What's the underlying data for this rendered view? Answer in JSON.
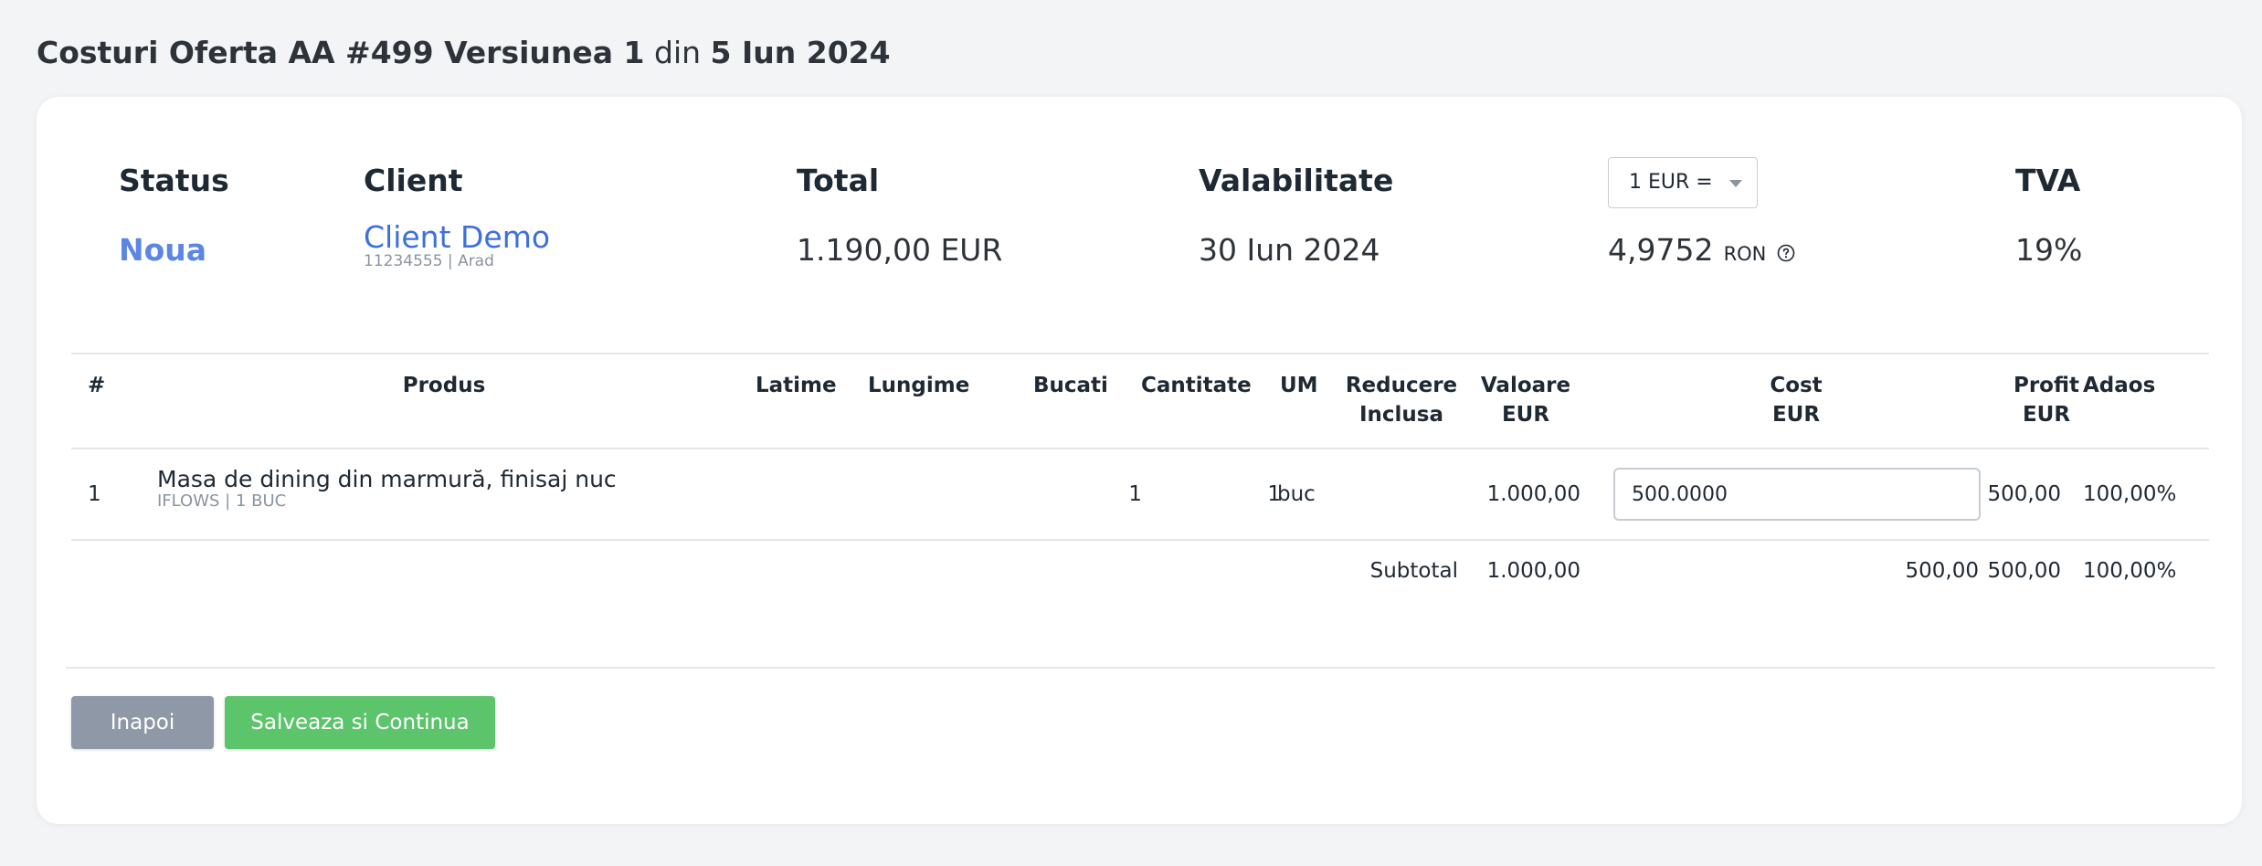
{
  "header": {
    "title_prefix": "Costuri Oferta AA #499 Versiunea 1",
    "title_mid": "din",
    "title_date": "5 Iun 2024"
  },
  "summary": {
    "status_label": "Status",
    "status_value": "Noua",
    "client_label": "Client",
    "client_name": "Client Demo",
    "client_meta": "11234555 | Arad",
    "total_label": "Total",
    "total_value": "1.190,00 EUR",
    "validity_label": "Valabilitate",
    "validity_value": "30 Iun 2024",
    "currency_select_value": "1 EUR =",
    "rate_value": "4,9752",
    "rate_unit": "RON",
    "vat_label": "TVA",
    "vat_value": "19%"
  },
  "table": {
    "headers": {
      "num": "#",
      "product": "Produs",
      "width": "Latime",
      "length": "Lungime",
      "pieces": "Bucati",
      "quantity": "Cantitate",
      "um": "UM",
      "discount_1": "Reducere",
      "discount_2": "Inclusa",
      "value_1": "Valoare",
      "value_2": "EUR",
      "cost_1": "Cost",
      "cost_2": "EUR",
      "profit_1": "Profit",
      "profit_2": "EUR",
      "markup": "Adaos"
    },
    "rows": [
      {
        "num": "1",
        "product": "Masa de dining din marmură, finisaj nuc",
        "product_meta": "IFLOWS | 1 BUC",
        "pieces": "1",
        "quantity": "1",
        "um": "buc",
        "value": "1.000,00",
        "cost": "500.0000",
        "profit": "500,00",
        "markup": "100,00%"
      }
    ],
    "subtotal": {
      "label": "Subtotal",
      "value": "1.000,00",
      "cost": "500,00",
      "profit": "500,00",
      "markup": "100,00%"
    }
  },
  "buttons": {
    "back": "Inapoi",
    "save": "Salveaza si Continua"
  },
  "colors": {
    "status": "#5b86e5",
    "client_link": "#3c6fe0",
    "back_button": "#8e98a6",
    "save_button": "#5cc56c"
  }
}
